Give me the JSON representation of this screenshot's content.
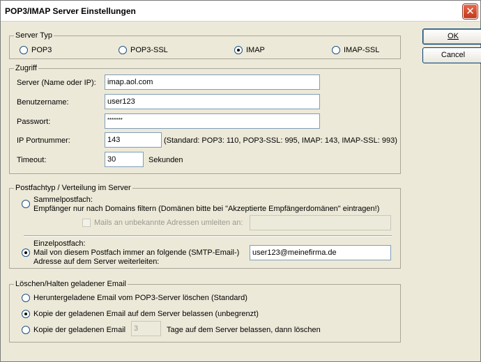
{
  "window": {
    "title": "POP3/IMAP Server Einstellungen",
    "close_glyph": "✕"
  },
  "buttons": {
    "ok": "OK",
    "cancel": "Cancel"
  },
  "server_typ": {
    "legend": "Server Typ",
    "options": [
      "POP3",
      "POP3-SSL",
      "IMAP",
      "IMAP-SSL"
    ],
    "selected": "IMAP"
  },
  "zugriff": {
    "legend": "Zugriff",
    "server_label": "Server (Name oder IP):",
    "server_value": "imap.aol.com",
    "user_label": "Benutzername:",
    "user_value": "user123",
    "password_label": "Passwort:",
    "password_value": "*******",
    "port_label": "IP Portnummer:",
    "port_value": "143",
    "port_hint": "(Standard: POP3: 110, POP3-SSL: 995, IMAP: 143, IMAP-SSL: 993)",
    "timeout_label": "Timeout:",
    "timeout_value": "30",
    "timeout_unit": "Sekunden"
  },
  "postfach": {
    "legend": "Postfachtyp / Verteilung im Server",
    "sammel_title": "Sammelpostfach:",
    "sammel_desc": "Empfänger nur nach Domains filtern (Domänen bitte bei \"Akzeptierte Empfängerdomänen\" eintragen!)",
    "unknown_label": "Mails an unbekannte Adressen umleiten an:",
    "unknown_value": "",
    "einzel_title": "Einzelpostfach:",
    "einzel_line1": "Mail von diesem Postfach immer an folgende (SMTP-Email-)",
    "einzel_line2": "Adresse auf dem Server weiterleiten:",
    "einzel_value": "user123@meinefirma.de",
    "selected": "Einzelpostfach"
  },
  "loeschen": {
    "legend": "Löschen/Halten geladener Email",
    "opt1": "Heruntergeladene Email vom POP3-Server löschen (Standard)",
    "opt2": "Kopie der geladenen Email auf dem Server belassen (unbegrenzt)",
    "opt3_prefix": "Kopie der geladenen Email",
    "opt3_days": "3",
    "opt3_suffix": "Tage auf dem Server belassen, dann löschen",
    "selected": "opt2"
  }
}
